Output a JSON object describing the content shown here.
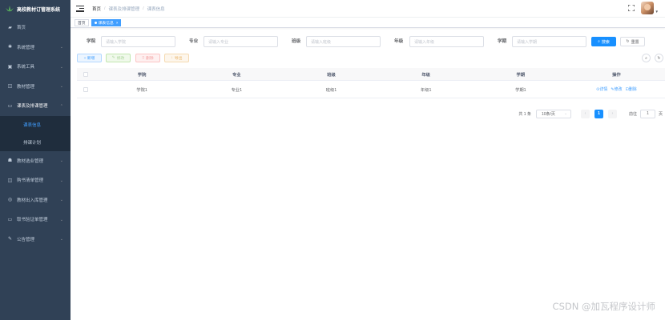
{
  "app": {
    "title": "高校教材订管理系统"
  },
  "sidebar": {
    "items": [
      {
        "label": "首页",
        "icon": "dashboard-icon"
      },
      {
        "label": "系统管理",
        "icon": "gear-icon"
      },
      {
        "label": "系统工具",
        "icon": "toolbox-icon"
      },
      {
        "label": "教材管理",
        "icon": "book-icon"
      },
      {
        "label": "课表及排课管理",
        "icon": "monitor-icon"
      },
      {
        "label": "教材选业管理",
        "icon": "user-group-icon"
      },
      {
        "label": "购书清单管理",
        "icon": "list-icon"
      },
      {
        "label": "教材出入库管理",
        "icon": "warehouse-icon"
      },
      {
        "label": "取书验证单管理",
        "icon": "verify-icon"
      },
      {
        "label": "公告管理",
        "icon": "edit-icon"
      }
    ],
    "submenu": [
      {
        "label": "课表信息",
        "active": true
      },
      {
        "label": "排课计划",
        "active": false
      }
    ]
  },
  "header": {
    "breadcrumb": [
      "首页",
      "课表及排课管理",
      "课表信息"
    ]
  },
  "tags": [
    {
      "label": "首页",
      "active": false
    },
    {
      "label": "课表信息",
      "active": true
    }
  ],
  "search": {
    "fields": [
      {
        "label": "学院",
        "placeholder": "请输入学院"
      },
      {
        "label": "专业",
        "placeholder": "请输入专业"
      },
      {
        "label": "班级",
        "placeholder": "请输入班级"
      },
      {
        "label": "年级",
        "placeholder": "请输入年级"
      },
      {
        "label": "学期",
        "placeholder": "请输入学期"
      }
    ],
    "search_label": "搜索",
    "reset_label": "重置"
  },
  "toolbar": {
    "add_label": "+ 新增",
    "edit_label": "修改",
    "delete_label": "删除",
    "export_label": "导出"
  },
  "table": {
    "headers": [
      "学院",
      "专业",
      "班级",
      "年级",
      "学期",
      "操作"
    ],
    "rows": [
      [
        "学院1",
        "专业1",
        "班级1",
        "年级1",
        "学期1"
      ]
    ],
    "ops": {
      "detail": "详情",
      "edit": "修改",
      "delete": "删除"
    }
  },
  "pagination": {
    "total_text": "共 1 条",
    "page_size": "10条/页",
    "current_page": "1",
    "goto_prefix": "前往",
    "goto_value": "1",
    "goto_suffix": "页"
  },
  "watermark": "CSDN @加瓦程序设计师",
  "colors": {
    "sidebar": "#304156",
    "primary": "#1890ff",
    "active_text": "#409eff"
  }
}
